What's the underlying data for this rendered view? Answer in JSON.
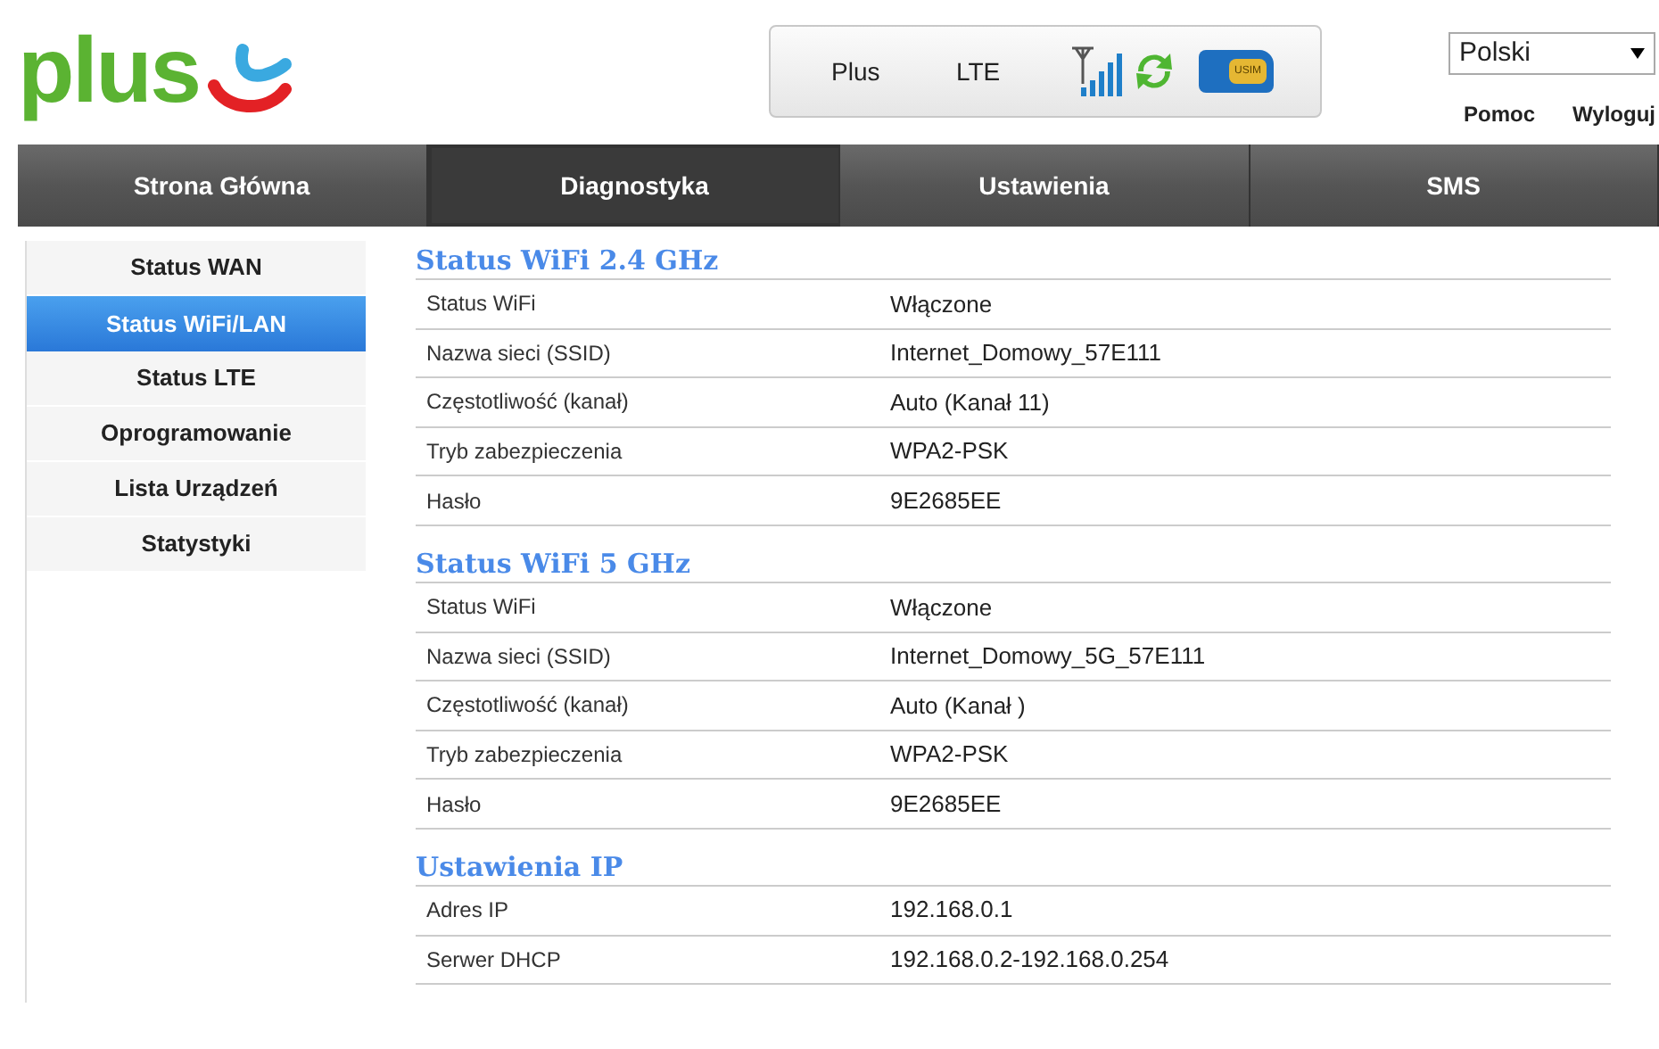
{
  "logo": {
    "text": "plus"
  },
  "status": {
    "operator": "Plus",
    "network": "LTE",
    "sim_label": "USIM"
  },
  "language": {
    "value": "Polski"
  },
  "links": [
    "Pomoc",
    "Wyloguj"
  ],
  "tabs": [
    {
      "label": "Strona Główna",
      "selected": false
    },
    {
      "label": "Diagnostyka",
      "selected": true
    },
    {
      "label": "Ustawienia",
      "selected": false
    },
    {
      "label": "SMS",
      "selected": false
    }
  ],
  "sidebar": {
    "items": [
      {
        "label": "Status WAN",
        "selected": false
      },
      {
        "label": "Status WiFi/LAN",
        "selected": true
      },
      {
        "label": "Status LTE",
        "selected": false
      },
      {
        "label": "Oprogramowanie",
        "selected": false
      },
      {
        "label": "Lista Urządzeń",
        "selected": false
      },
      {
        "label": "Statystyki",
        "selected": false
      }
    ]
  },
  "sections": [
    {
      "title": "Status WiFi 2.4 GHz",
      "rows": [
        [
          "Status WiFi",
          "Włączone"
        ],
        [
          "Nazwa sieci (SSID)",
          "Internet_Domowy_57E111"
        ],
        [
          "Częstotliwość (kanał)",
          "Auto (Kanał 11)"
        ],
        [
          "Tryb zabezpieczenia",
          "WPA2-PSK"
        ],
        [
          "Hasło",
          "9E2685EE"
        ]
      ]
    },
    {
      "title": "Status WiFi 5 GHz",
      "rows": [
        [
          "Status WiFi",
          "Włączone"
        ],
        [
          "Nazwa sieci (SSID)",
          "Internet_Domowy_5G_57E111"
        ],
        [
          "Częstotliwość (kanał)",
          "Auto (Kanał )"
        ],
        [
          "Tryb zabezpieczenia",
          "WPA2-PSK"
        ],
        [
          "Hasło",
          "9E2685EE"
        ]
      ]
    },
    {
      "title": "Ustawienia IP",
      "rows": [
        [
          "Adres IP",
          "192.168.0.1"
        ],
        [
          "Serwer DHCP",
          "192.168.0.2-192.168.0.254"
        ]
      ]
    }
  ]
}
